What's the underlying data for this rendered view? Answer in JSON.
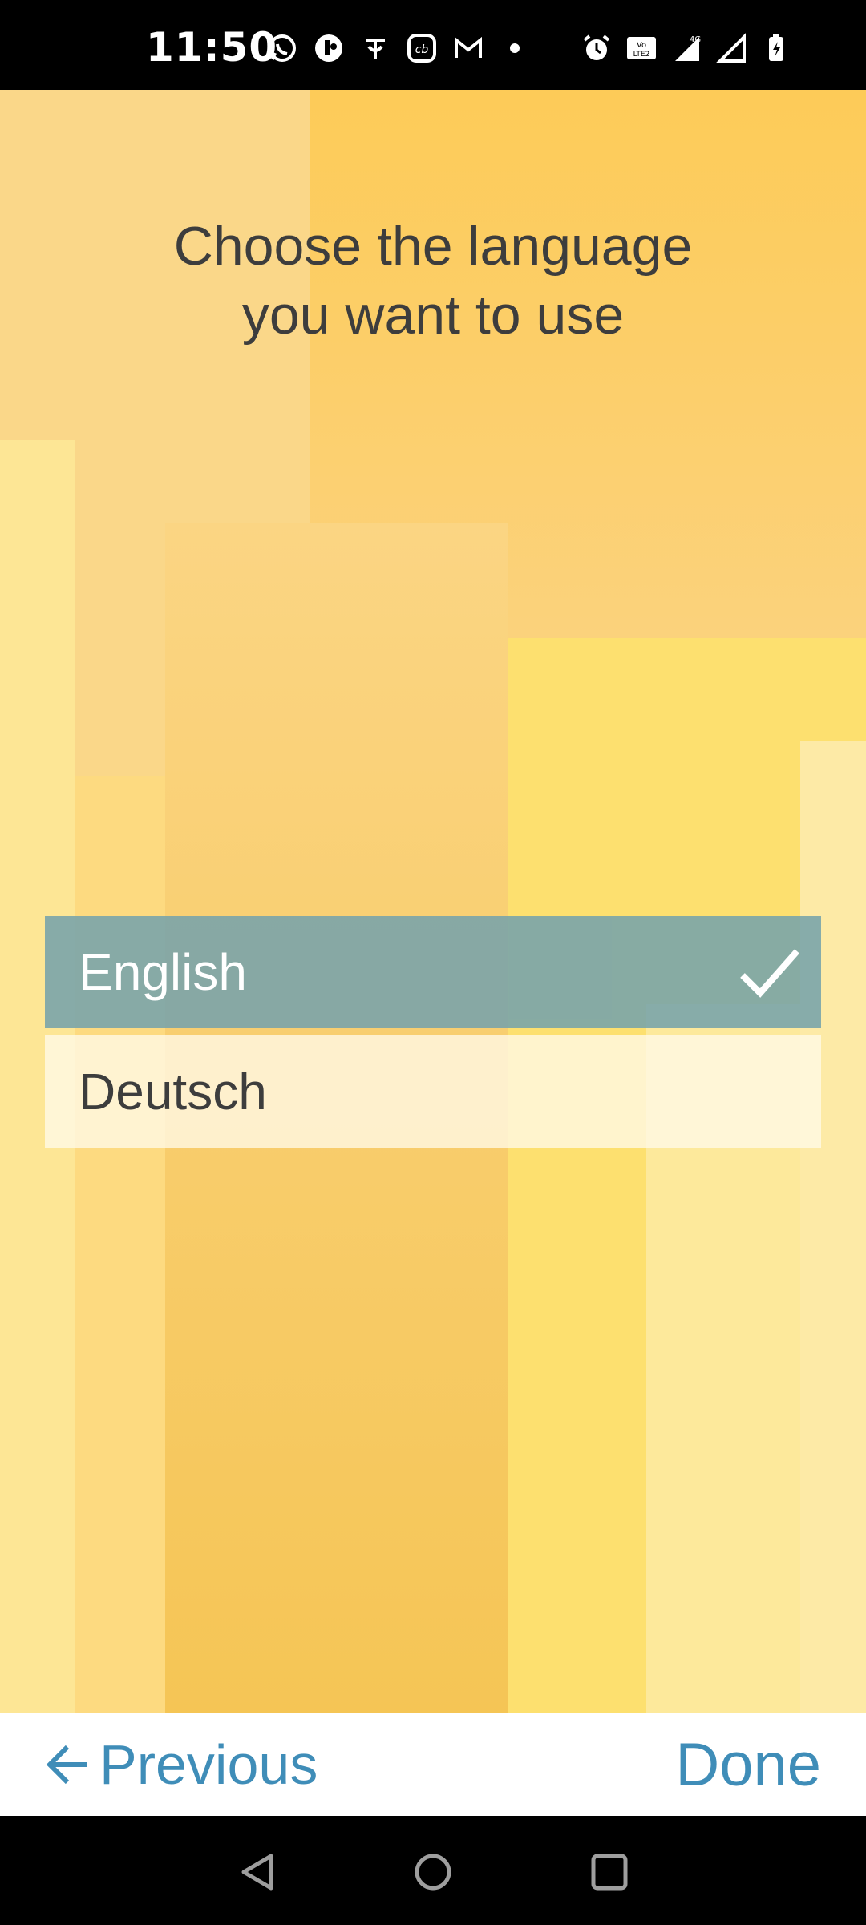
{
  "status_bar": {
    "time": "11:50",
    "left_icons": [
      "whatsapp-icon",
      "messenger-icon",
      "phonepe-icon",
      "cb-app-icon",
      "gmail-icon",
      "dot-icon"
    ],
    "right_icons": [
      "alarm-icon",
      "volte-icon",
      "data-4g-icon",
      "signal-icon",
      "battery-charging-icon"
    ]
  },
  "screen": {
    "title_line1": "Choose the language",
    "title_line2": "you want to use"
  },
  "languages": [
    {
      "label": "English",
      "selected": true
    },
    {
      "label": "Deutsch",
      "selected": false
    }
  ],
  "bottom_nav": {
    "previous_label": "Previous",
    "done_label": "Done"
  },
  "colors": {
    "accent": "#3f8db8",
    "selected_bg": "#76a3ab",
    "background": "#fccc58"
  }
}
